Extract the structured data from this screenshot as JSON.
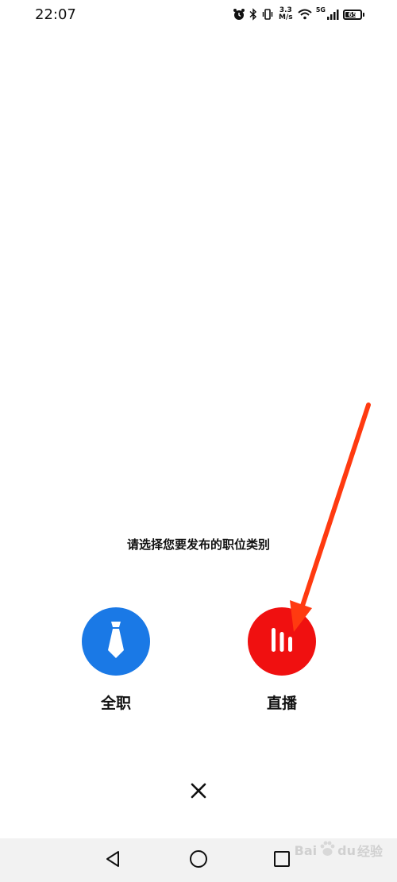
{
  "status_bar": {
    "time": "22:07",
    "net_speed_value": "3.3",
    "net_speed_unit": "M/s",
    "signal_type": "5G",
    "battery_level": "65",
    "icons": [
      "alarm-icon",
      "bluetooth-icon",
      "vibrate-icon",
      "wifi-icon",
      "cellular-signal-icon",
      "battery-icon"
    ]
  },
  "prompt": "请选择您要发布的职位类别",
  "options": [
    {
      "label": "全职",
      "icon": "necktie-icon",
      "color": "#1a79e6"
    },
    {
      "label": "直播",
      "icon": "live-bars-icon",
      "color": "#f01010"
    }
  ],
  "close_icon": "close-icon",
  "nav": [
    "back-icon",
    "home-icon",
    "recent-apps-icon"
  ],
  "watermark": {
    "brand_a": "Bai",
    "brand_b": "du",
    "suffix": "经验"
  },
  "annotation_color": "#ff3a10"
}
